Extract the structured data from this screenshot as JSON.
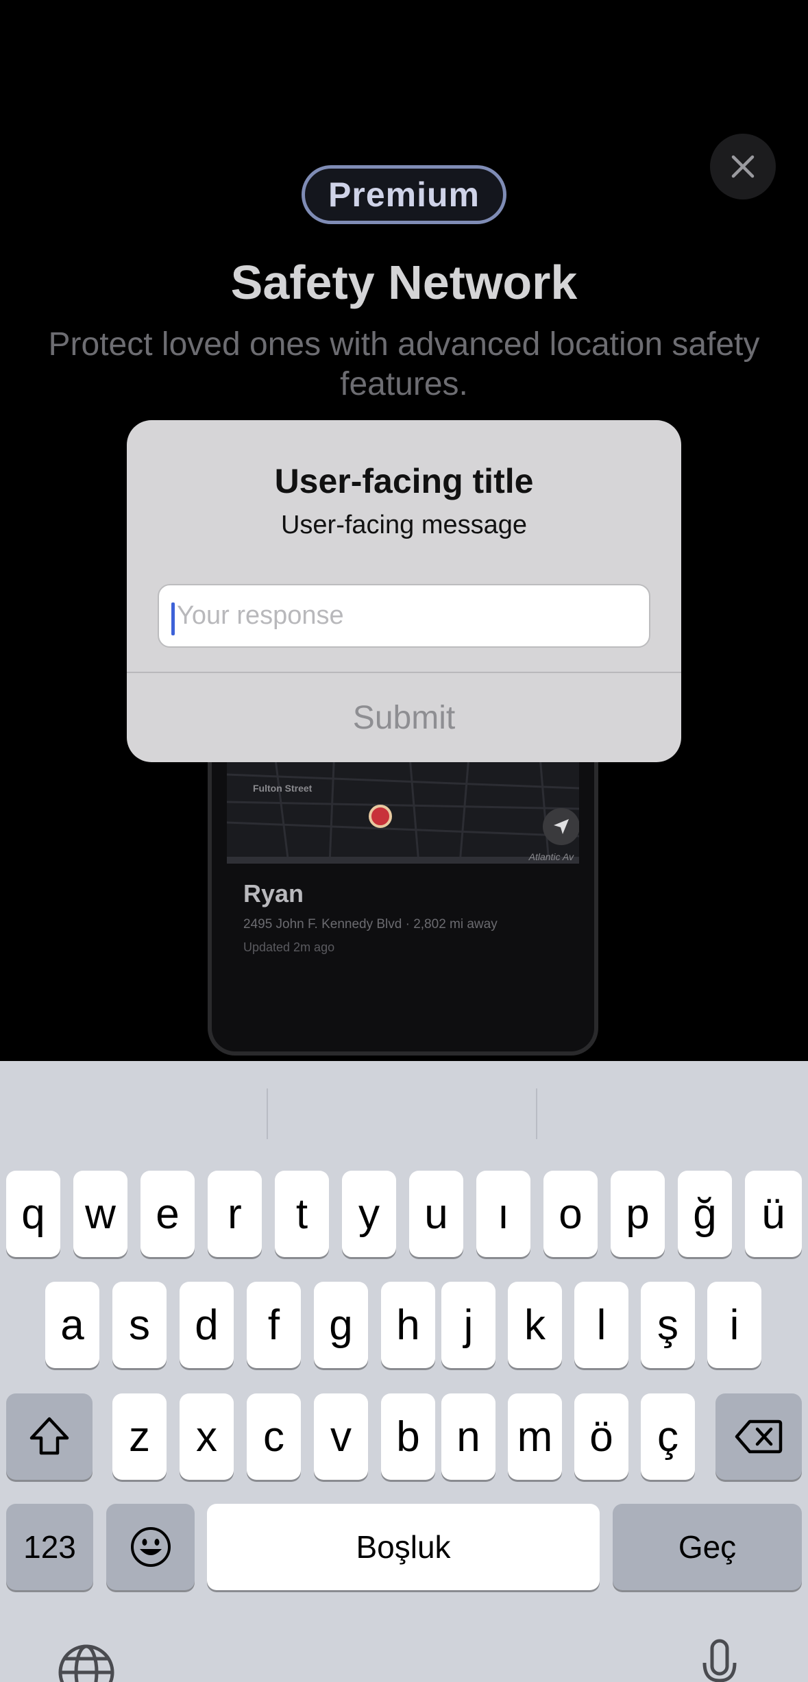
{
  "paywall": {
    "badge": "Premium",
    "title": "Safety Network",
    "subtitle": "Protect loved ones with advanced location safety features.",
    "close_icon": "close-icon"
  },
  "phone_preview": {
    "street_1": "Fulton Street",
    "street_2": "Atlantic Av",
    "person_name": "Ryan",
    "person_address": "2495 John F. Kennedy Blvd · 2,802 mi away",
    "person_updated": "Updated 2m ago"
  },
  "alert": {
    "title": "User-facing title",
    "message": "User-facing message",
    "input_value": "",
    "input_placeholder": "Your response",
    "submit_label": "Submit"
  },
  "keyboard": {
    "row1": [
      "q",
      "w",
      "e",
      "r",
      "t",
      "y",
      "u",
      "ı",
      "o",
      "p",
      "ğ",
      "ü"
    ],
    "row2": [
      "a",
      "s",
      "d",
      "f",
      "g",
      "h",
      "j",
      "k",
      "l",
      "ş",
      "i"
    ],
    "row3": [
      "z",
      "x",
      "c",
      "v",
      "b",
      "n",
      "m",
      "ö",
      "ç"
    ],
    "numbers_label": "123",
    "space_label": "Boşluk",
    "return_label": "Geç",
    "shift_icon": "shift-icon",
    "delete_icon": "delete-icon",
    "emoji_icon": "emoji-icon",
    "globe_icon": "globe-icon",
    "mic_icon": "microphone-icon"
  }
}
